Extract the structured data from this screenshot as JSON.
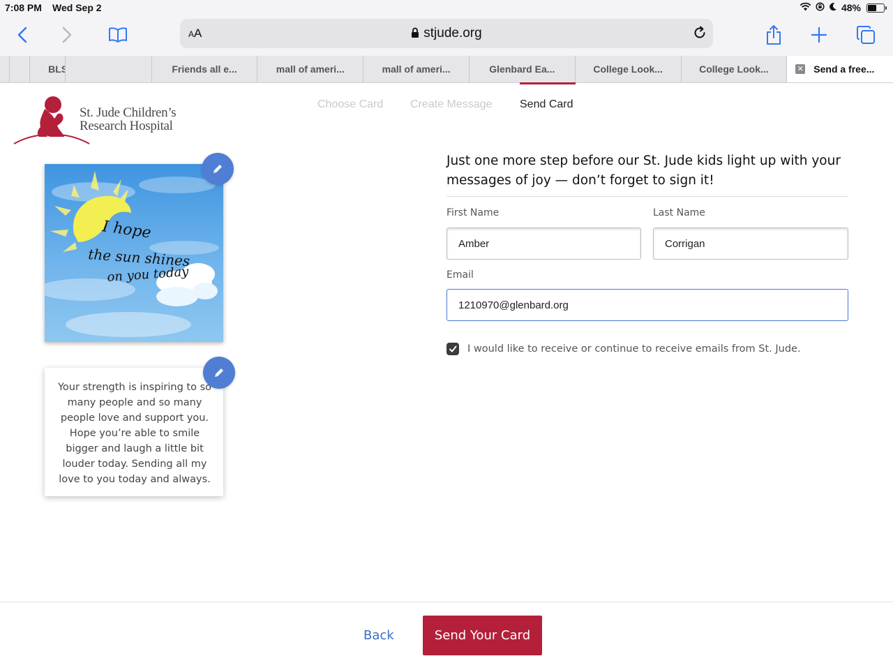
{
  "status_bar": {
    "time": "7:08 PM",
    "date": "Wed Sep 2",
    "battery": "48%",
    "battery_level": 0.48
  },
  "browser": {
    "text_size_label": "AA",
    "url_host": "stjude.org",
    "tabs": [
      {
        "label": ""
      },
      {
        "label": ""
      },
      {
        "label": "BLS Search."
      },
      {
        "label": "Friends all e..."
      },
      {
        "label": "mall of ameri..."
      },
      {
        "label": "mall of ameri..."
      },
      {
        "label": "Glenbard Ea..."
      },
      {
        "label": "College Look..."
      },
      {
        "label": "College Look..."
      },
      {
        "label": "Send a free..."
      }
    ],
    "accent_color": "#3478f6"
  },
  "header": {
    "logo_line1": "St. Jude Children’s",
    "logo_line2": "Research Hospital",
    "brand_color": "#b41f3a",
    "steps": [
      {
        "label": "Choose Card"
      },
      {
        "label": "Create Message"
      },
      {
        "label": "Send Card"
      }
    ],
    "active_step": "Send Card"
  },
  "card": {
    "image_text_line1": "I hope",
    "image_text_line2": "the sun shines",
    "image_text_line3": "on you today",
    "message": "Your strength is inspiring to so many people and so many people love and support you. Hope you’re able to smile bigger and laugh a little bit louder today. Sending all my love to you today and always."
  },
  "form": {
    "heading": "Just one more step before our St. Jude kids light up with your messages of joy — don’t forget to sign it!",
    "first_name_label": "First Name",
    "first_name_value": "Amber",
    "last_name_label": "Last Name",
    "last_name_value": "Corrigan",
    "email_label": "Email",
    "email_value": "1210970@glenbard.org",
    "consent_checked": true,
    "consent_text": "I would like to receive or continue to receive emails from St. Jude."
  },
  "footer": {
    "back_label": "Back",
    "send_label": "Send Your Card"
  }
}
